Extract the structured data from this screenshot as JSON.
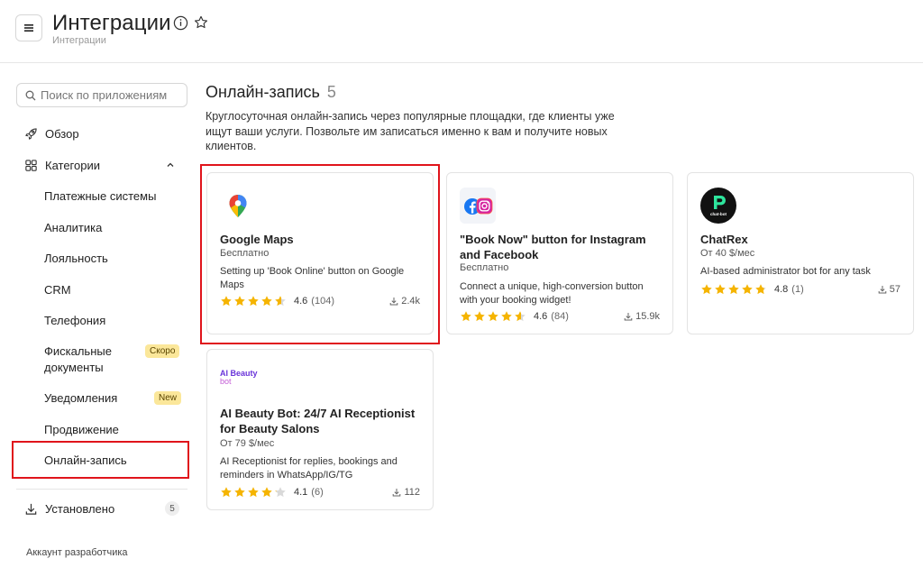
{
  "header": {
    "title": "Интеграции",
    "breadcrumb": "Интеграции",
    "menu_icon": "hamburger-icon",
    "info_icon": "info-icon",
    "favorite_icon": "star-outline-icon"
  },
  "sidebar": {
    "search_placeholder": "Поиск по приложениям",
    "overview_label": "Обзор",
    "categories_label": "Категории",
    "categories": [
      {
        "label": "Платежные системы"
      },
      {
        "label": "Аналитика"
      },
      {
        "label": "Лояльность"
      },
      {
        "label": "CRM"
      },
      {
        "label": "Телефония"
      },
      {
        "label": "Фискальные документы",
        "badge": "Скоро"
      },
      {
        "label": "Уведомления",
        "badge": "New"
      },
      {
        "label": "Продвижение"
      },
      {
        "label": "Онлайн-запись",
        "active": true
      }
    ],
    "installed_label": "Установлено",
    "installed_count": "5",
    "developer_account": "Аккаунт разработчика"
  },
  "main": {
    "section_title": "Онлайн-запись",
    "section_count": "5",
    "section_description": "Круглосуточная онлайн-запись через популярные площадки, где клиенты уже ищут ваши услуги. Позвольте им записаться именно к вам и получите новых клиентов.",
    "cards": [
      {
        "name": "Google Maps",
        "price": "Бесплатно",
        "description": "Setting up 'Book Online' button on Google Maps",
        "rating": 4.6,
        "rating_text": "4.6",
        "reviews": "(104)",
        "downloads": "2.4k",
        "icon": "google-maps-icon"
      },
      {
        "name": "\"Book Now\" button for Instagram and Facebook",
        "price": "Бесплатно",
        "description": "Connect a unique, high-conversion button with your booking widget!",
        "rating": 4.6,
        "rating_text": "4.6",
        "reviews": "(84)",
        "downloads": "15.9k",
        "icon": "facebook-instagram-icon"
      },
      {
        "name": "ChatRex",
        "price": "От 40 $/мес",
        "description": "AI-based administrator bot for any task",
        "rating": 4.8,
        "rating_text": "4.8",
        "reviews": "(1)",
        "downloads": "57",
        "icon": "chatbot-icon",
        "logo_text": "chat-bot"
      },
      {
        "name": "AI Beauty Bot: 24/7 AI Receptionist for Beauty Salons",
        "price": "От 79 $/мес",
        "description": "AI Receptionist for replies, bookings and reminders in WhatsApp/IG/TG",
        "rating": 4.1,
        "rating_text": "4.1",
        "reviews": "(6)",
        "downloads": "112",
        "icon": "ai-beauty-bot-logo",
        "logo_text_1": "AI Beauty",
        "logo_text_2": "bot"
      }
    ]
  },
  "colors": {
    "star": "#f5b400",
    "star_empty": "#d9d9d9",
    "highlight": "#e0141b",
    "badge_bg": "#fbe79a"
  }
}
